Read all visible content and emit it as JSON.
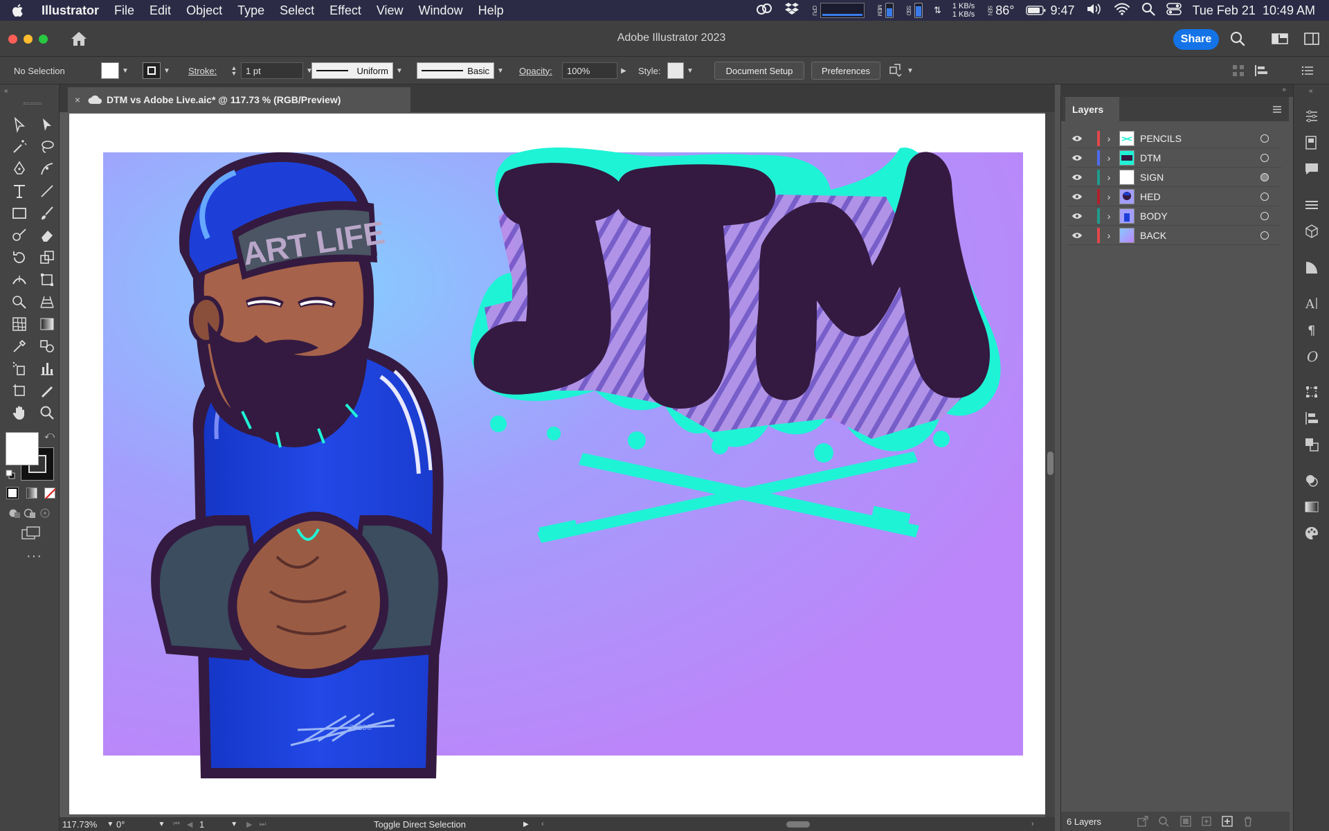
{
  "menubar": {
    "app_name": "Illustrator",
    "items": [
      "File",
      "Edit",
      "Object",
      "Type",
      "Select",
      "Effect",
      "View",
      "Window",
      "Help"
    ],
    "status": {
      "cpu_label": "CPU",
      "mem_label": "MEM",
      "ssd_label": "SSD",
      "net_up": "1 KB/s",
      "net_down": "1 KB/s",
      "sensor_label": "SEN",
      "temperature": "86°",
      "battery_time": "9:47",
      "datetime": "Tue Feb 21  10:49 AM"
    }
  },
  "titlebar": {
    "title": "Adobe Illustrator 2023",
    "share_label": "Share"
  },
  "controlbar": {
    "selection_label": "No Selection",
    "stroke_label": "Stroke:",
    "stroke_value": "1 pt",
    "profile_value": "Uniform",
    "brush_value": "Basic",
    "opacity_label": "Opacity:",
    "opacity_value": "100%",
    "style_label": "Style:",
    "document_setup": "Document Setup",
    "preferences": "Preferences"
  },
  "document": {
    "tab_title": "DTM vs Adobe Live.aic* @ 117.73 % (RGB/Preview)",
    "close_glyph": "×"
  },
  "artwork": {
    "cap_text": "ART LIFE",
    "graffiti_text": "DTM",
    "signature_year": "2023©"
  },
  "statusbar": {
    "zoom": "117.73%",
    "rotation": "0°",
    "artboard": "1",
    "status_text": "Toggle Direct Selection"
  },
  "layers_panel": {
    "title": "Layers",
    "layers": [
      {
        "name": "PENCILS",
        "color": "#e2474b",
        "target_filled": false
      },
      {
        "name": "DTM",
        "color": "#4d6cf0",
        "target_filled": false
      },
      {
        "name": "SIGN",
        "color": "#1e9c8c",
        "target_filled": true
      },
      {
        "name": "HED",
        "color": "#b0202a",
        "target_filled": false
      },
      {
        "name": "BODY",
        "color": "#1e9c8c",
        "target_filled": false
      },
      {
        "name": "BACK",
        "color": "#e2474b",
        "target_filled": false
      }
    ],
    "count_label": "6 Layers"
  },
  "colors": {
    "accent": "#1473e6",
    "teal": "#19f2d2",
    "purple_dark": "#35193f",
    "background_purple": "#b987fa",
    "background_blue": "#88c8ff",
    "jersey_blue": "#1d3fd8"
  }
}
